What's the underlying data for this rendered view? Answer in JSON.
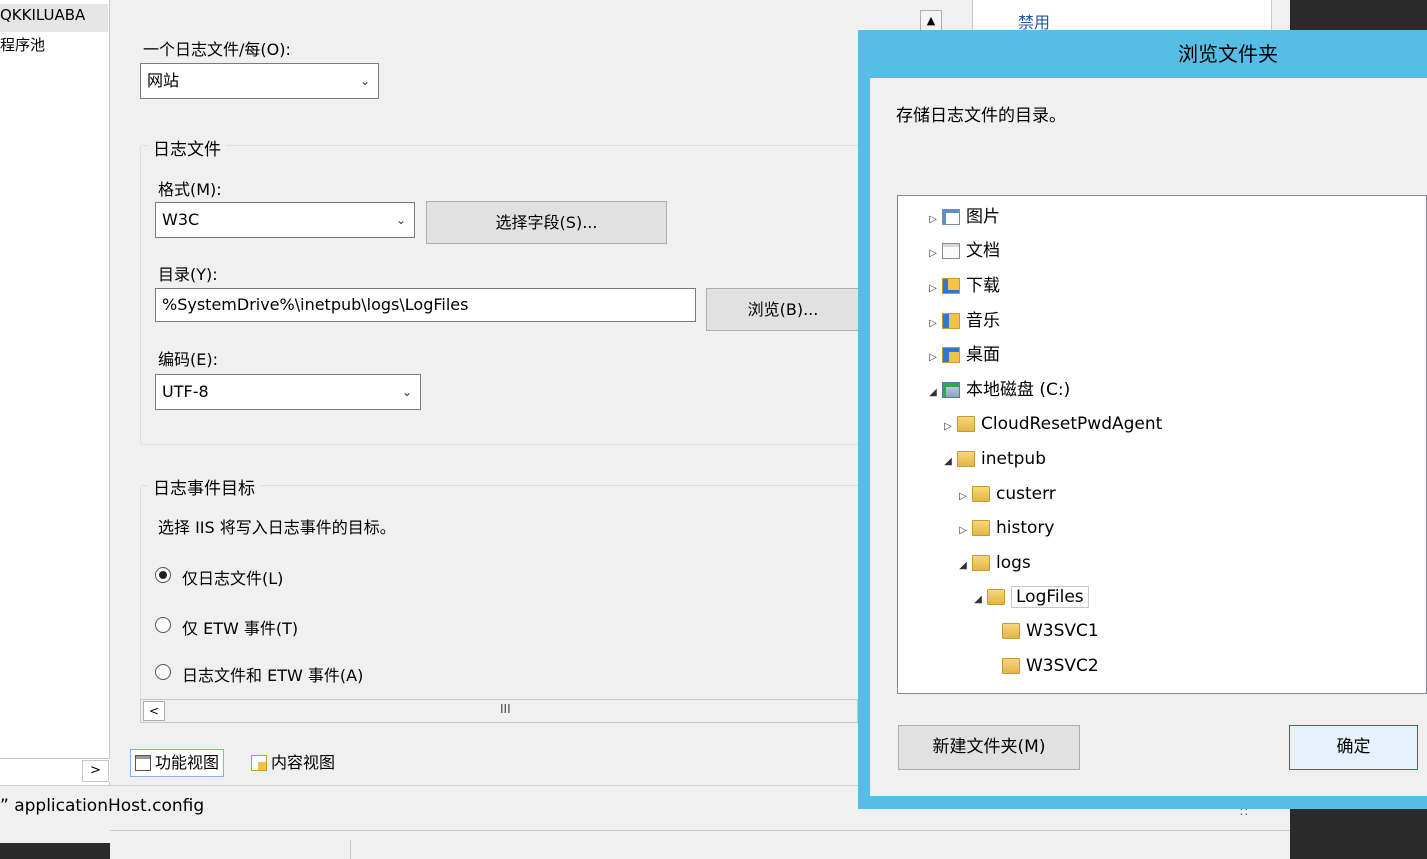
{
  "left_tree": {
    "server": "QKKILUABA",
    "app_pools": "程序池"
  },
  "right_pane": {
    "disable": "禁用"
  },
  "logging": {
    "one_log_file_per_label": "一个日志文件/每(O):",
    "one_log_file_per_value": "网站",
    "log_file_group": "日志文件",
    "format_label": "格式(M):",
    "format_value": "W3C",
    "select_fields_button": "选择字段(S)...",
    "directory_label": "目录(Y):",
    "directory_value": "%SystemDrive%\\inetpub\\logs\\LogFiles",
    "browse_button": "浏览(B)...",
    "encoding_label": "编码(E):",
    "encoding_value": "UTF-8",
    "event_destination_group": "日志事件目标",
    "event_destination_desc": "选择 IIS 将写入日志事件的目标。",
    "radio_log_only": "仅日志文件(L)",
    "radio_etw_only": "仅 ETW 事件(T)",
    "radio_both": "日志文件和 ETW 事件(A)",
    "selected_destination": "仅日志文件(L)"
  },
  "view_tabs": {
    "features_view": "功能视图",
    "content_view": "内容视图"
  },
  "status_bar": {
    "text": "” applicationHost.config"
  },
  "dialog": {
    "title": "浏览文件夹",
    "description": "存储日志文件的目录。",
    "tree": [
      {
        "label": "图片",
        "icon": "pictures-library-icon",
        "expander": "collapsed"
      },
      {
        "label": "文档",
        "icon": "documents-library-icon",
        "expander": "collapsed"
      },
      {
        "label": "下载",
        "icon": "downloads-folder-icon",
        "expander": "collapsed"
      },
      {
        "label": "音乐",
        "icon": "music-library-icon",
        "expander": "collapsed"
      },
      {
        "label": "桌面",
        "icon": "desktop-folder-icon",
        "expander": "collapsed"
      },
      {
        "label": "本地磁盘 (C:)",
        "icon": "local-disk-icon",
        "expander": "expanded"
      },
      {
        "label": "CloudResetPwdAgent",
        "icon": "folder-icon",
        "expander": "collapsed"
      },
      {
        "label": "inetpub",
        "icon": "folder-icon",
        "expander": "expanded"
      },
      {
        "label": "custerr",
        "icon": "folder-icon",
        "expander": "collapsed"
      },
      {
        "label": "history",
        "icon": "folder-icon",
        "expander": "collapsed"
      },
      {
        "label": "logs",
        "icon": "folder-icon",
        "expander": "expanded"
      },
      {
        "label": "LogFiles",
        "icon": "folder-icon",
        "expander": "expanded",
        "selected": true
      },
      {
        "label": "W3SVC1",
        "icon": "folder-icon",
        "expander": "none"
      },
      {
        "label": "W3SVC2",
        "icon": "folder-icon",
        "expander": "none"
      }
    ],
    "new_folder_button": "新建文件夹(M)",
    "ok_button": "确定"
  }
}
